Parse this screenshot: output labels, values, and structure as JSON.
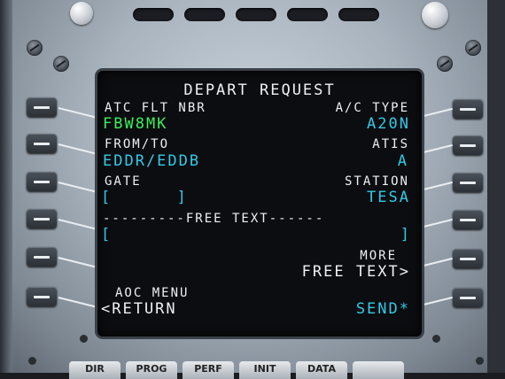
{
  "screen": {
    "title": "DEPART REQUEST",
    "left": [
      {
        "label": "ATC FLT NBR",
        "value": "FBW8MK",
        "value_color": "green"
      },
      {
        "label": "FROM/TO",
        "value": "EDDR/EDDB",
        "value_color": "cyan"
      },
      {
        "label": "GATE",
        "value": "[      ]",
        "value_color": "cyan"
      },
      {
        "label": "",
        "value": "[",
        "value_color": "cyan"
      },
      {
        "label": "",
        "value": "",
        "value_color": "white"
      },
      {
        "label": "AOC MENU",
        "value": "<RETURN",
        "value_color": "white"
      }
    ],
    "right": [
      {
        "label": "A/C TYPE",
        "value": "A20N",
        "value_color": "cyan"
      },
      {
        "label": "ATIS",
        "value": "A",
        "value_color": "cyan"
      },
      {
        "label": "STATION",
        "value": "TESA",
        "value_color": "cyan"
      },
      {
        "label": "",
        "value": "]",
        "value_color": "cyan"
      },
      {
        "label": "MORE",
        "value": "FREE TEXT>",
        "value_color": "white"
      },
      {
        "label": "",
        "value": "SEND*",
        "value_color": "cyan"
      }
    ],
    "free_text_divider": "---------FREE TEXT------"
  },
  "bottom_keys": [
    "DIR",
    "PROG",
    "PERF",
    "INIT",
    "DATA",
    ""
  ],
  "colors": {
    "green": "#3cf05a",
    "cyan": "#35c9e6",
    "white": "#eef0f2",
    "screen_bg": "#0b0d10",
    "bezel": "#b8c1cb"
  }
}
